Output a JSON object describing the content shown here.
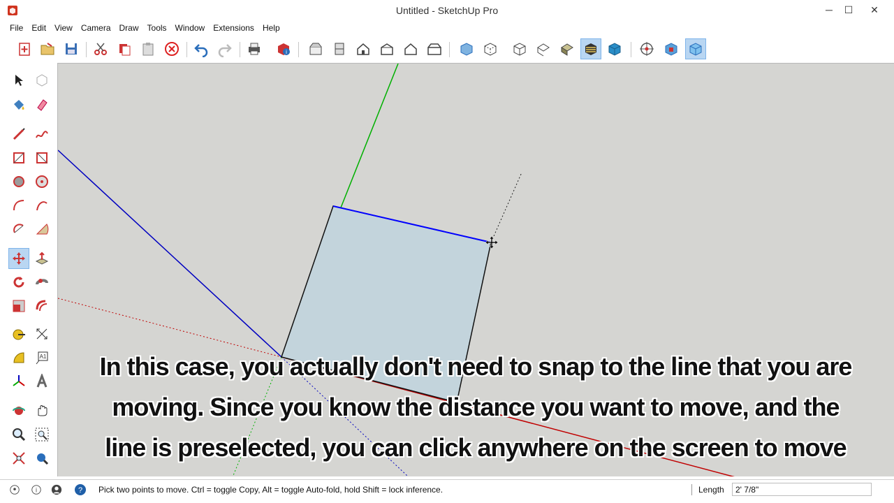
{
  "window": {
    "title": "Untitled - SketchUp Pro",
    "minimize": "─",
    "maximize": "☐",
    "close": "✕"
  },
  "menu": [
    "File",
    "Edit",
    "View",
    "Camera",
    "Draw",
    "Tools",
    "Window",
    "Extensions",
    "Help"
  ],
  "toolbar": {
    "icons": [
      "new-icon",
      "open-icon",
      "save-icon",
      "cut-icon",
      "copy-icon",
      "paste-icon",
      "erase-icon",
      "undo-icon",
      "redo-icon",
      "print-icon",
      "model-info-icon",
      "iso-view-icon",
      "top-view-icon",
      "front-view-icon",
      "right-view-icon",
      "back-view-icon",
      "left-view-icon",
      "xray-icon",
      "back-edges-icon",
      "wireframe-icon",
      "hidden-line-icon",
      "shaded-icon",
      "shaded-textures-icon",
      "monochrome-icon",
      "orbit-icon",
      "warehouse-icon",
      "extension-warehouse-icon"
    ],
    "active": [
      "shaded-textures-icon",
      "extension-warehouse-icon"
    ]
  },
  "palette": {
    "active": "move-tool"
  },
  "caption": {
    "line1": "In this case, you actually don't need to snap to the line that you are",
    "line2": "moving. Since you know the distance you want to move, and the",
    "line3": "line is preselected, you can click anywhere on the screen to move"
  },
  "statusbar": {
    "hint": "Pick two points to move.  Ctrl = toggle Copy, Alt = toggle Auto-fold, hold Shift = lock inference.",
    "measure_label": "Length",
    "measure_value": "2' 7/8\""
  },
  "colors": {
    "viewport_bg": "#d5d5d2",
    "face_fill": "#c3d4dc",
    "red_axis": "#c00000",
    "green_axis": "#00b000",
    "blue_axis": "#0000c0",
    "selection_blue": "#0000ff"
  }
}
